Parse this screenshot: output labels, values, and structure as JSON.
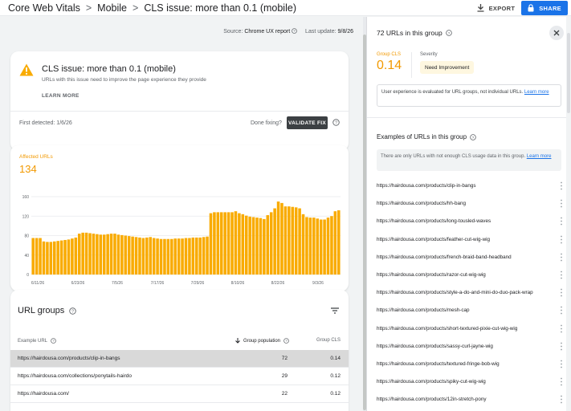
{
  "breadcrumb": {
    "root": "Core Web Vitals",
    "sep": ">",
    "device": "Mobile",
    "current": "CLS issue: more than 0.1 (mobile)"
  },
  "header_actions": {
    "export_label": "EXPORT",
    "share_label": "SHARE"
  },
  "source": {
    "label": "Source:",
    "value": "Chrome UX report",
    "update_label": "Last update:",
    "update_value": "9/8/26"
  },
  "issue": {
    "title": "CLS issue: more than 0.1 (mobile)",
    "subtitle": "URLs with this issue need to improve the page experience they provide",
    "learn_more": "LEARN MORE",
    "first_detected": "First detected: 1/6/26",
    "done_fixing": "Done fixing?",
    "validate_fix": "VALIDATE FIX",
    "warning_color": "#f9ab00"
  },
  "affected": {
    "label": "Affected URLs",
    "value": "134"
  },
  "chart_data": {
    "type": "bar",
    "ylim": [
      0,
      160
    ],
    "y_ticks": [
      0,
      40,
      80,
      120,
      160
    ],
    "x_tick_labels": [
      "6/11/26",
      "6/23/26",
      "7/5/26",
      "7/17/26",
      "7/29/26",
      "8/10/26",
      "8/22/26",
      "9/3/26"
    ],
    "values": [
      75,
      75,
      75,
      68,
      67,
      67,
      68,
      69,
      70,
      71,
      72,
      74,
      76,
      84,
      86,
      86,
      85,
      84,
      83,
      82,
      82,
      83,
      84,
      84,
      82,
      81,
      80,
      79,
      78,
      77,
      76,
      75,
      76,
      77,
      75,
      74,
      73,
      73,
      73,
      73,
      74,
      74,
      74,
      75,
      75,
      76,
      76,
      76,
      77,
      78,
      126,
      128,
      128,
      128,
      128,
      128,
      128,
      130,
      126,
      124,
      121,
      119,
      118,
      117,
      116,
      114,
      122,
      128,
      136,
      150,
      147,
      140,
      140,
      139,
      138,
      136,
      124,
      118,
      117,
      117,
      115,
      113,
      113,
      117,
      120,
      130,
      132
    ],
    "bar_color": "#f9ab00"
  },
  "url_groups": {
    "title": "URL groups",
    "headers": {
      "url": "Example URL",
      "population": "Group population",
      "cls": "Group CLS"
    },
    "rows": [
      {
        "url": "https://hairdousa.com/products/clip-in-bangs",
        "population": "72",
        "cls": "0.14"
      },
      {
        "url": "https://hairdousa.com/collections/ponytails-hairdo",
        "population": "29",
        "cls": "0.12"
      },
      {
        "url": "https://hairdousa.com/",
        "population": "22",
        "cls": "0.12"
      }
    ]
  },
  "panel": {
    "title": "72 URLs in this group",
    "group_cls_label": "Group CLS",
    "group_cls_value": "0.14",
    "severity_label": "Severity",
    "severity_value": "Need Improvement",
    "note": "User experience is evaluated for URL groups, not individual URLs.",
    "note_link": "Learn more",
    "examples_title": "Examples of URLs in this group",
    "info": "There are only URLs with not enough CLS usage data in this group.",
    "info_link": "Learn more",
    "urls": [
      "https://hairdousa.com/products/clip-in-bangs",
      "https://hairdousa.com/products/hh-bang",
      "https://hairdousa.com/products/long-tousled-waves",
      "https://hairdousa.com/products/feather-cut-wig-wig",
      "https://hairdousa.com/products/french-braid-band-headband",
      "https://hairdousa.com/products/razor-cut-wig-wig",
      "https://hairdousa.com/products/style-a-do-and-mini-do-duo-pack-wrap",
      "https://hairdousa.com/products/mesh-cap",
      "https://hairdousa.com/products/short-textured-pixie-cut-wig-wig",
      "https://hairdousa.com/products/sassy-curl-jayne-wig",
      "https://hairdousa.com/products/textured-fringe-bob-wig",
      "https://hairdousa.com/products/spiky-cut-wig-wig",
      "https://hairdousa.com/products/12in-stretch-pony"
    ]
  }
}
